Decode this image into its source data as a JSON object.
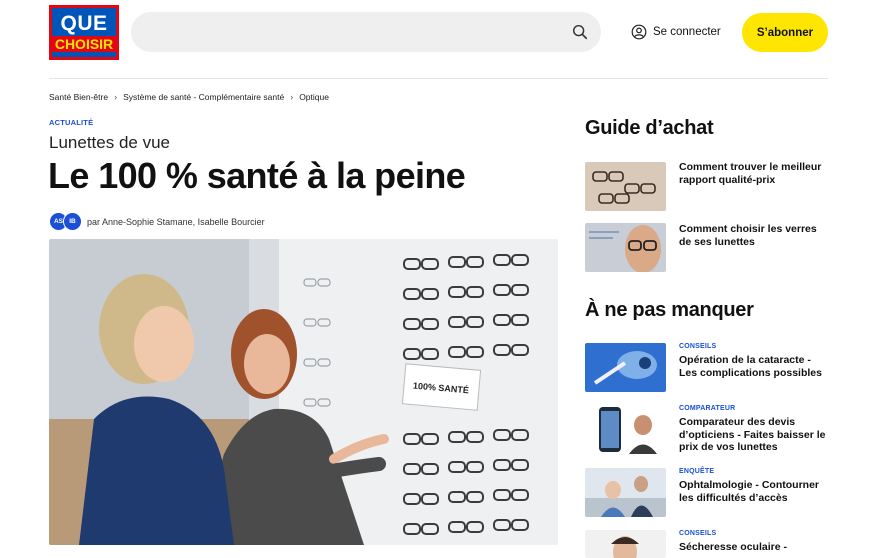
{
  "header": {
    "logo_top": "QUE",
    "logo_bottom": "CHOISIR",
    "search_placeholder": "",
    "login_label": "Se connecter",
    "subscribe_label": "S’abonner"
  },
  "breadcrumb": [
    "Santé Bien-être",
    "Système de santé - Complémentaire santé",
    "Optique"
  ],
  "article": {
    "tag": "ACTUALITÉ",
    "subtitle": "Lunettes de vue",
    "title": "Le 100 % santé à la peine",
    "authors_prefix": "par",
    "authors": "Anne-Sophie Stamane, Isabelle Bourcier",
    "avatars": [
      "AS",
      "IB"
    ],
    "image_label": "100% SANTÉ"
  },
  "guide": {
    "title": "Guide d’achat",
    "items": [
      {
        "title": "Comment trouver le meilleur rapport qualité-prix"
      },
      {
        "title": "Comment choisir les verres de ses lunettes"
      }
    ]
  },
  "miss": {
    "title": "À ne pas manquer",
    "items": [
      {
        "tag": "CONSEILS",
        "title": "Opération de la cataracte - Les complications possibles"
      },
      {
        "tag": "COMPARATEUR",
        "title": "Comparateur des devis d’opticiens - Faites baisser le prix de vos lunettes"
      },
      {
        "tag": "ENQUÊTE",
        "title": "Ophtalmologie - Contourner les difficultés d’accès"
      },
      {
        "tag": "CONSEILS",
        "title": "Sécheresse oculaire -"
      }
    ]
  },
  "colors": {
    "brand_blue": "#0055b8",
    "brand_red": "#e30613",
    "accent_yellow": "#ffe600",
    "tag_blue": "#1a4fd6"
  }
}
